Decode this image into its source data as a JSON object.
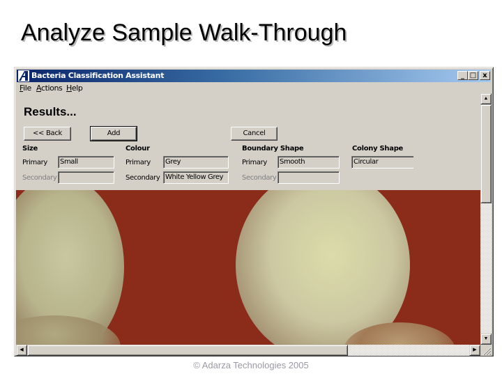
{
  "slide": {
    "title": "Analyze Sample Walk-Through",
    "footer": "© Adarza Technologies 2005"
  },
  "window": {
    "title": "Bacteria Classification Assistant",
    "app_icon": "adarza-logo-icon",
    "controls": {
      "minimize": "_",
      "maximize": "□",
      "close": "x"
    },
    "title_gradient": [
      "#0a246a",
      "#a6caf0"
    ]
  },
  "menu": {
    "items": [
      {
        "label": "File",
        "accel": "F",
        "rest": "ile"
      },
      {
        "label": "Actions",
        "accel": "A",
        "rest": "ctions"
      },
      {
        "label": "Help",
        "accel": "H",
        "rest": "elp"
      }
    ]
  },
  "form": {
    "heading": "Results...",
    "buttons": {
      "back": "<< Back",
      "add": "Add",
      "cancel": "Cancel"
    },
    "groups": {
      "size": {
        "label": "Size",
        "primary_label": "Primary",
        "primary_value": "Small",
        "secondary_label": "Secondary",
        "secondary_value": ""
      },
      "colour": {
        "label": "Colour",
        "primary_label": "Primary",
        "primary_value": "Grey",
        "secondary_label": "Secondary",
        "secondary_value": "White Yellow Grey"
      },
      "boundary_shape": {
        "label": "Boundary Shape",
        "primary_label": "Primary",
        "primary_value": "Smooth",
        "secondary_label": "Secondary",
        "secondary_value": ""
      },
      "colony_shape": {
        "label": "Colony Shape",
        "primary_value": "Circular"
      }
    }
  },
  "image": {
    "description": "Bacterial colonies on red agar plate",
    "background_color": "#8b2c1a",
    "colony_color": "#d8d8a8"
  },
  "scrollbars": {
    "up_arrow": "▲",
    "down_arrow": "▼",
    "left_arrow": "◀",
    "right_arrow": "▶"
  }
}
